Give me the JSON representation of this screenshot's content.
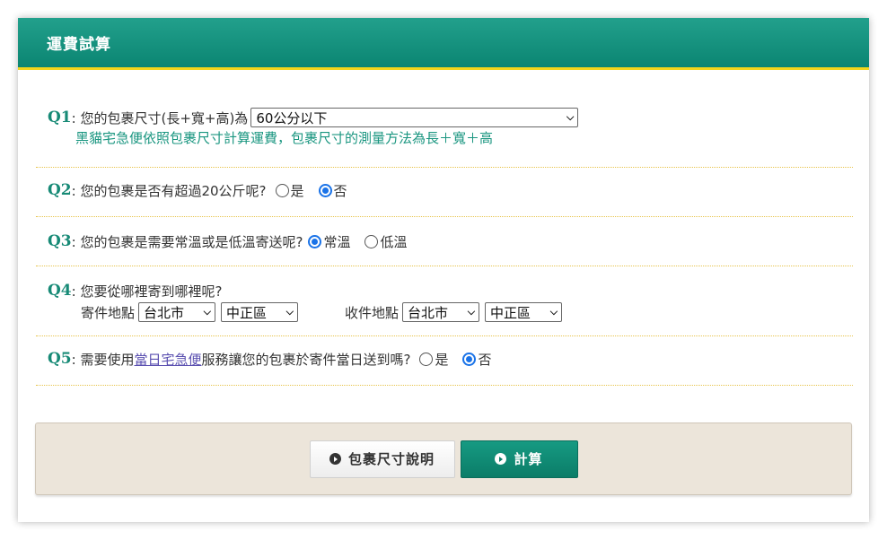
{
  "header": {
    "title": "運費試算"
  },
  "q1": {
    "num": "Q1",
    "text": ": 您的包裹尺寸(長+寬+高)為",
    "selected": "60公分以下",
    "note": "黑貓宅急便依照包裹尺寸計算運費，包裹尺寸的測量方法為長＋寬＋高"
  },
  "q2": {
    "num": "Q2",
    "text": ": 您的包裹是否有超過20公斤呢?",
    "options": [
      {
        "label": "是",
        "checked": false
      },
      {
        "label": "否",
        "checked": true
      }
    ]
  },
  "q3": {
    "num": "Q3",
    "text": ": 您的包裹是需要常溫或是低溫寄送呢?",
    "options": [
      {
        "label": "常溫",
        "checked": true
      },
      {
        "label": "低溫",
        "checked": false
      }
    ]
  },
  "q4": {
    "num": "Q4",
    "text": ": 您要從哪裡寄到哪裡呢?",
    "sender_label": "寄件地點",
    "sender_city": "台北市",
    "sender_district": "中正區",
    "receiver_label": "收件地點",
    "receiver_city": "台北市",
    "receiver_district": "中正區"
  },
  "q5": {
    "num": "Q5",
    "text_before": ": 需要使用",
    "link": "當日宅急便",
    "text_after": "服務讓您的包裹於寄件當日送到嗎?",
    "options": [
      {
        "label": "是",
        "checked": false
      },
      {
        "label": "否",
        "checked": true
      }
    ]
  },
  "footer": {
    "size_button": "包裹尺寸說明",
    "calc_button": "計算"
  },
  "icons": {
    "chevron": "chevron-down-icon",
    "play": "play-circle-icon"
  },
  "colors": {
    "brand": "#0b8572",
    "accent_yellow": "#f2d51c",
    "question_number": "#178a76",
    "radio_checked": "#1a73e8"
  }
}
